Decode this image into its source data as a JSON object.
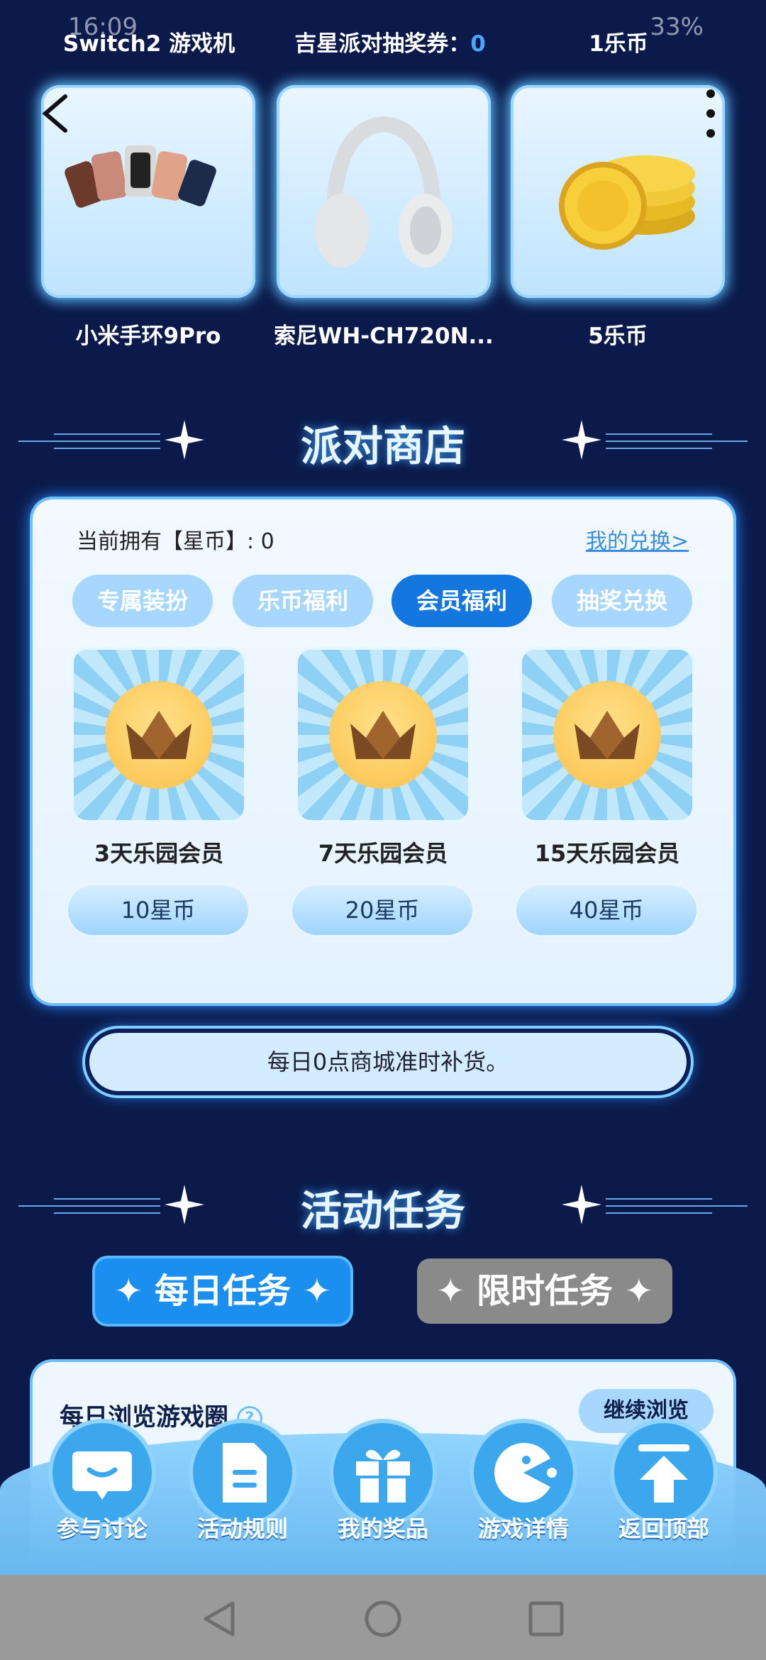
{
  "status_bar": {
    "time": "16:09",
    "battery": "33%"
  },
  "top_row": {
    "labels": [
      {
        "text": "Switch2 游戏机"
      },
      {
        "text": "吉星派对抽奖券：",
        "value": "0"
      },
      {
        "text": "1乐币"
      }
    ]
  },
  "prizes": [
    {
      "name": "小米手环9Pro",
      "icon": "smart-band-image"
    },
    {
      "name": "索尼WH-CH720N...",
      "icon": "headphones-image"
    },
    {
      "name": "5乐币",
      "icon": "coins-image"
    }
  ],
  "shop": {
    "title": "派对商店",
    "owned_label": "当前拥有【星币】: 0",
    "my_exchange": "我的兑换>",
    "tabs": [
      "专属装扮",
      "乐币福利",
      "会员福利",
      "抽奖兑换"
    ],
    "active_tab": "会员福利",
    "items": [
      {
        "name": "3天乐园会员",
        "price": "10星币"
      },
      {
        "name": "7天乐园会员",
        "price": "20星币"
      },
      {
        "name": "15天乐园会员",
        "price": "40星币"
      }
    ]
  },
  "notice": "每日0点商城准时补货。",
  "tasks": {
    "title": "活动任务",
    "tabs": [
      "✦ 每日任务 ✦",
      "✦ 限时任务 ✦"
    ],
    "active_tab": "✦ 每日任务 ✦",
    "card_title": "每日浏览游戏圈",
    "card_button": "继续浏览"
  },
  "dock": [
    {
      "label": "参与讨论",
      "icon": "chat-icon"
    },
    {
      "label": "活动规则",
      "icon": "document-icon"
    },
    {
      "label": "我的奖品",
      "icon": "gift-icon"
    },
    {
      "label": "游戏详情",
      "icon": "pacman-icon"
    },
    {
      "label": "返回顶部",
      "icon": "back-to-top-icon"
    }
  ],
  "colors": {
    "background": "#0b1a4a",
    "accent": "#1477e0",
    "tab_inactive": "#a7d7ff",
    "link": "#3c8fd8"
  }
}
